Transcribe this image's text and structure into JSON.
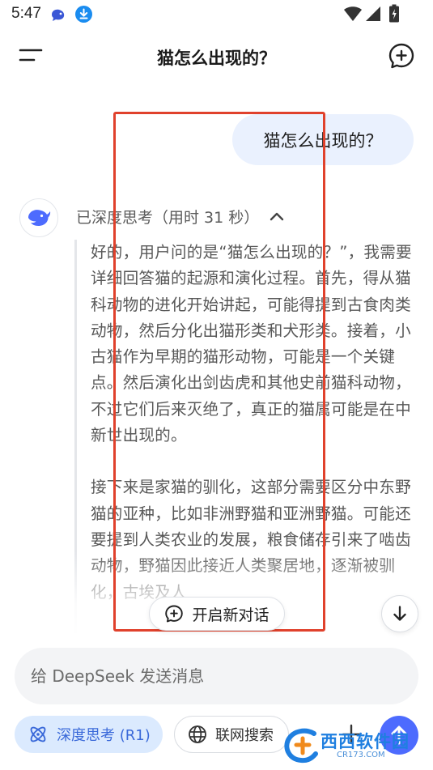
{
  "status_bar": {
    "time": "5:47"
  },
  "header": {
    "title": "猫怎么出现的？"
  },
  "user_message": {
    "text": "猫怎么出现的？"
  },
  "assistant": {
    "thinking_label": "已深度思考（用时 31 秒）",
    "thinking_paragraphs": [
      "好的，用户问的是“猫怎么出现的？”，我需要详细回答猫的起源和演化过程。首先，得从猫科动物的进化开始讲起，可能得提到古食肉类动物，然后分化出猫形类和犬形类。接着，小古猫作为早期的猫形动物，可能是一个关键点。然后演化出剑齿虎和其他史前猫科动物，不过它们后来灭绝了，真正的猫属可能是在中新世出现的。",
      "接下来是家猫的驯化，这部分需要区分中东野猫的亚种，比如非洲野猫和亚洲野猫。可能还要提到人类农业的发展，粮食储存引来了啮齿动物，野猫因此接近人类聚居地，逐渐被驯化，古埃及人"
    ]
  },
  "floating": {
    "new_dialog_label": "开启新对话"
  },
  "composer": {
    "placeholder": "给 DeepSeek 发送消息",
    "deep_think_label": "深度思考 (R1)",
    "web_search_label": "联网搜索"
  },
  "watermark": {
    "text": "西西软件园",
    "sub": "CR173.COM"
  },
  "colors": {
    "accent": "#4d6bfe",
    "chip_bg": "#dbeafe",
    "chip_text": "#3a69d9",
    "annotation": "#e0412c",
    "user_bubble": "#eaf1fe"
  }
}
